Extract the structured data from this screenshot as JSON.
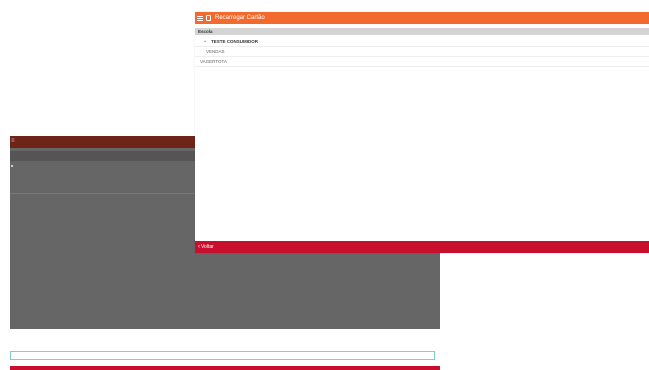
{
  "dialog": {
    "title": "Recarregar Cartão",
    "section_label": "Escola",
    "group_label": "TESTE CONSUMIDOR",
    "sub_label": "VENDAS",
    "item_label": "VAGERTOTA",
    "back_label": "Voltar"
  },
  "icons": {
    "menu": "hamburger-menu-icon",
    "card": "card-icon",
    "expand": "chevron-down-icon",
    "back": "chevron-left-icon"
  },
  "colors": {
    "header": "#f26a2e",
    "footer": "#c8102e",
    "section": "#d4d4d4",
    "overlay": "#666666",
    "bg_topbar": "#6f2418"
  }
}
